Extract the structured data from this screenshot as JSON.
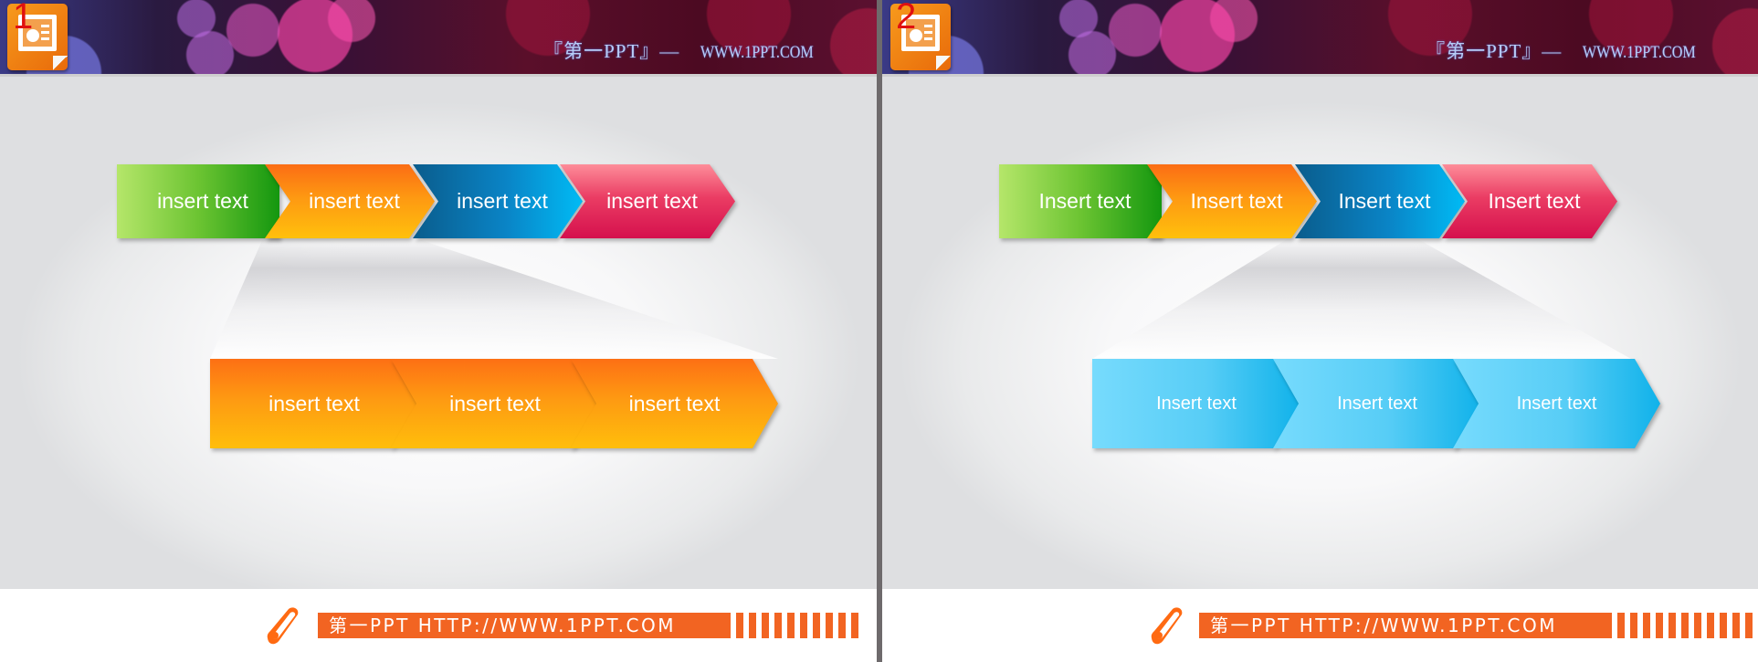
{
  "slides": [
    {
      "number": "1",
      "banner": {
        "title": "『第一PPT』—",
        "url": "WWW.1PPT.COM"
      },
      "top_row": [
        {
          "label": "insert text",
          "color": "green"
        },
        {
          "label": "insert text",
          "color": "orange"
        },
        {
          "label": "insert text",
          "color": "blue"
        },
        {
          "label": "insert text",
          "color": "pink"
        }
      ],
      "zoomed_item": "orange",
      "bottom_row": [
        {
          "label": "insert text",
          "color": "orange"
        },
        {
          "label": "insert text",
          "color": "orange"
        },
        {
          "label": "insert text",
          "color": "orange"
        }
      ],
      "footer": {
        "icon": "pencil-icon",
        "text": "第一PPT HTTP://WWW.1PPT.COM"
      }
    },
    {
      "number": "2",
      "banner": {
        "title": "『第一PPT』—",
        "url": "WWW.1PPT.COM"
      },
      "top_row": [
        {
          "label": "Insert text",
          "color": "green"
        },
        {
          "label": "Insert text",
          "color": "orange"
        },
        {
          "label": "Insert text",
          "color": "blue"
        },
        {
          "label": "Insert text",
          "color": "pink"
        }
      ],
      "zoomed_item": "blue",
      "bottom_row": [
        {
          "label": "Insert text",
          "color": "cyan"
        },
        {
          "label": "Insert text",
          "color": "cyan"
        },
        {
          "label": "Insert text",
          "color": "cyan"
        }
      ],
      "footer": {
        "icon": "pencil-icon",
        "text": "第一PPT HTTP://WWW.1PPT.COM"
      }
    }
  ],
  "colors": {
    "green": "#14970f",
    "orange": "#fe9912",
    "blue": "#0a84c6",
    "pink": "#d5104d",
    "cyan": "#57cdf6",
    "footer_accent": "#f26422",
    "slide_number": "#e01010"
  }
}
